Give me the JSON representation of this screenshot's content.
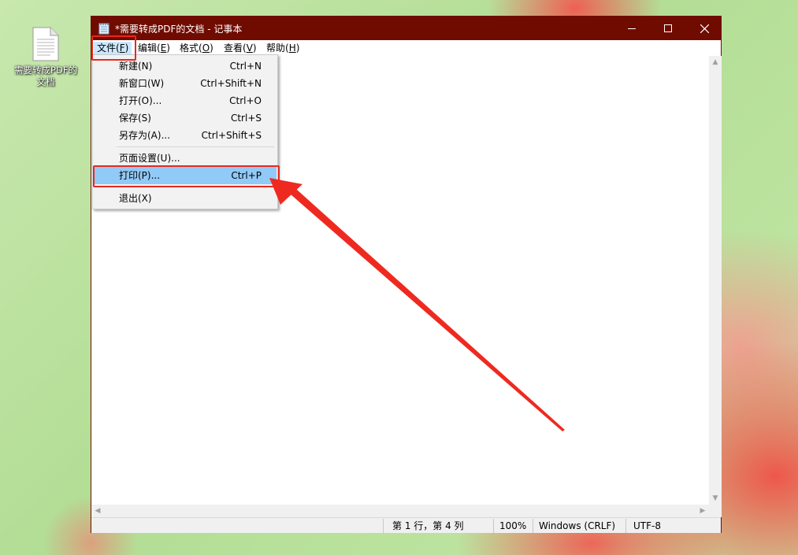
{
  "desktop": {
    "file_icon_label": "需要转成PDF的文档"
  },
  "window": {
    "title": "*需要转成PDF的文档 - 记事本",
    "controls": {
      "minimize": "—",
      "maximize": "☐",
      "close": "✕"
    }
  },
  "menubar": {
    "items": [
      {
        "label": "文件(",
        "key": "F",
        "end": ")"
      },
      {
        "label": "编辑(",
        "key": "E",
        "end": ")"
      },
      {
        "label": "格式(",
        "key": "O",
        "end": ")"
      },
      {
        "label": "查看(",
        "key": "V",
        "end": ")"
      },
      {
        "label": "帮助(",
        "key": "H",
        "end": ")"
      }
    ]
  },
  "file_menu": {
    "items": [
      {
        "label": "新建(N)",
        "shortcut": "Ctrl+N"
      },
      {
        "label": "新窗口(W)",
        "shortcut": "Ctrl+Shift+N"
      },
      {
        "label": "打开(O)...",
        "shortcut": "Ctrl+O"
      },
      {
        "label": "保存(S)",
        "shortcut": "Ctrl+S"
      },
      {
        "label": "另存为(A)...",
        "shortcut": "Ctrl+Shift+S"
      },
      {
        "label": "页面设置(U)...",
        "shortcut": ""
      },
      {
        "label": "打印(P)...",
        "shortcut": "Ctrl+P"
      },
      {
        "label": "退出(X)",
        "shortcut": ""
      }
    ]
  },
  "statusbar": {
    "position": "第 1 行，第 4 列",
    "zoom": "100%",
    "line_ending": "Windows (CRLF)",
    "encoding": "UTF-8"
  },
  "scrollbar": {
    "up": "▲",
    "down": "▼",
    "left": "◀",
    "right": "▶"
  },
  "colors": {
    "titlebar": "#700b00",
    "menu_highlight": "#91c9f7",
    "annotation": "#e8281e"
  }
}
